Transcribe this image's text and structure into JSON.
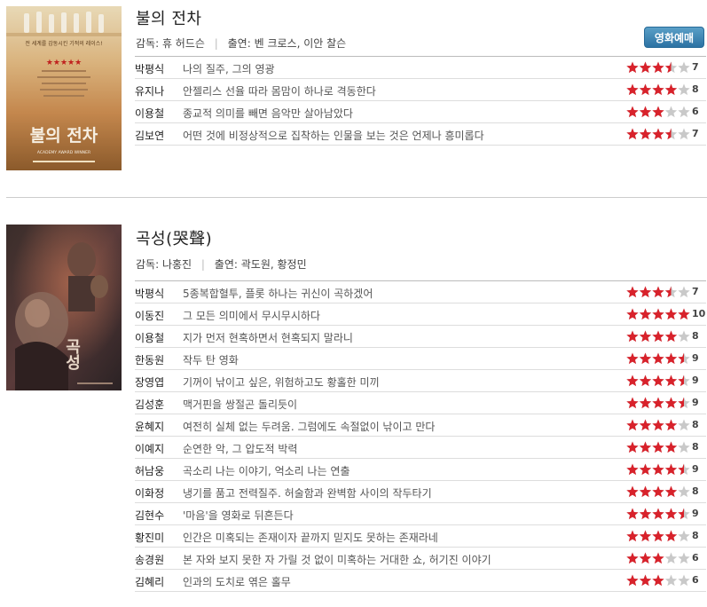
{
  "movies": [
    {
      "title": "불의 전차",
      "director_label": "감독:",
      "director": "휴 허드슨",
      "cast_label": "출연:",
      "cast": "벤 크로스, 이안 찰슨",
      "booking_label": "영화예매",
      "poster": {
        "tagline": "전 세계를 감동시킨 기적의 레이스!",
        "title": "불의 전차",
        "subtitle": "ACADEMY AWARD WINNER"
      },
      "reviews": [
        {
          "critic": "박평식",
          "comment": "나의 질주, 그의 영광",
          "score": "7",
          "rating": 3.5
        },
        {
          "critic": "유지나",
          "comment": "안젤리스 선율 따라 몸맘이 하나로 격동한다",
          "score": "8",
          "rating": 4
        },
        {
          "critic": "이용철",
          "comment": "종교적 의미를 빼면 음악만 살아남았다",
          "score": "6",
          "rating": 3
        },
        {
          "critic": "김보연",
          "comment": "어떤 것에 비정상적으로 집착하는 인물을 보는 것은 언제나 흥미롭다",
          "score": "7",
          "rating": 3.5
        }
      ]
    },
    {
      "title": "곡성(哭聲)",
      "director_label": "감독:",
      "director": "나홍진",
      "cast_label": "출연:",
      "cast": "곽도원, 황정민",
      "poster": {
        "title": "곡성"
      },
      "reviews": [
        {
          "critic": "박평식",
          "comment": "5종복합혈투, 플롯 하나는 귀신이 곡하겠어",
          "score": "7",
          "rating": 3.5
        },
        {
          "critic": "이동진",
          "comment": "그 모든 의미에서 무시무시하다",
          "score": "10",
          "rating": 5
        },
        {
          "critic": "이용철",
          "comment": "지가 먼저 현혹하면서 현혹되지 말라니",
          "score": "8",
          "rating": 4
        },
        {
          "critic": "한동원",
          "comment": "작두 탄 영화",
          "score": "9",
          "rating": 4.5
        },
        {
          "critic": "장영엽",
          "comment": "기꺼이 낚이고 싶은, 위험하고도 황홀한 미끼",
          "score": "9",
          "rating": 4.5
        },
        {
          "critic": "김성훈",
          "comment": "맥거핀을 쌍절곤 돌리듯이",
          "score": "9",
          "rating": 4.5
        },
        {
          "critic": "윤혜지",
          "comment": "여전히 실체 없는 두려움. 그럼에도 속절없이 낚이고 만다",
          "score": "8",
          "rating": 4
        },
        {
          "critic": "이예지",
          "comment": "순연한 악, 그 압도적 박력",
          "score": "8",
          "rating": 4
        },
        {
          "critic": "허남웅",
          "comment": "곡소리 나는 이야기, 억소리 나는 연출",
          "score": "9",
          "rating": 4.5
        },
        {
          "critic": "이화정",
          "comment": "냉기를 품고 전력질주. 허술함과 완벽함 사이의 작두타기",
          "score": "8",
          "rating": 4
        },
        {
          "critic": "김현수",
          "comment": "'마음'을 영화로 뒤흔든다",
          "score": "9",
          "rating": 4.5
        },
        {
          "critic": "황진미",
          "comment": "인간은 미혹되는 존재이자 끝까지 믿지도 못하는 존재라네",
          "score": "8",
          "rating": 4
        },
        {
          "critic": "송경원",
          "comment": "본 자와 보지 못한 자 가릴 것 없이 미혹하는 거대한 쇼, 허기진 이야기",
          "score": "6",
          "rating": 3
        },
        {
          "critic": "김혜리",
          "comment": "인과의 도치로 엮은 홀무",
          "score": "6",
          "rating": 3
        }
      ]
    }
  ],
  "colors": {
    "star_on": "#d8222b",
    "star_off": "#c9c9c9",
    "button": "#3a83b4"
  }
}
